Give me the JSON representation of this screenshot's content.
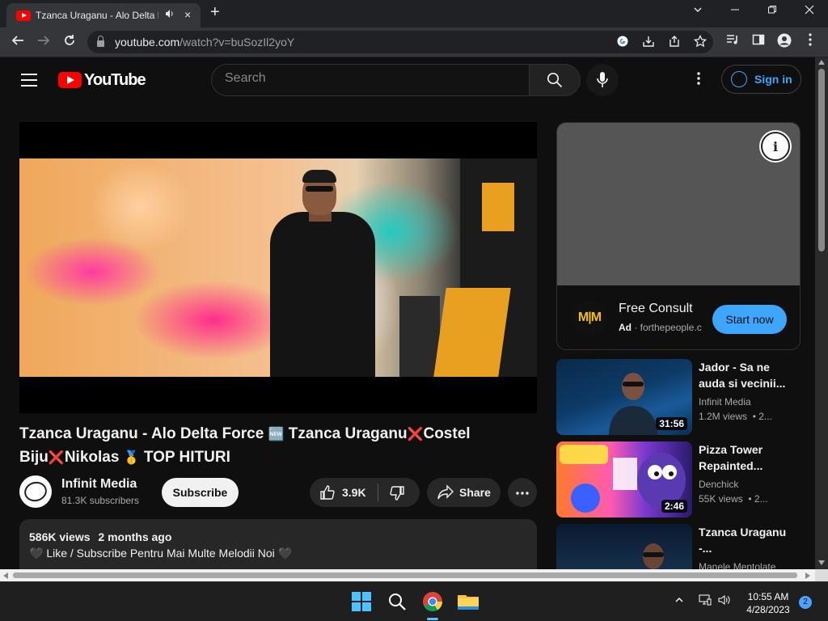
{
  "browser": {
    "tab_title": "Tzanca Uraganu - Alo Delta Force",
    "url_host": "youtube.com",
    "url_path": "/watch?v=buSozIl2yoY",
    "new_tab_symbol": "+",
    "close_symbol": "×"
  },
  "youtube": {
    "logo_text": "YouTube",
    "search_placeholder": "Search",
    "sign_in": "Sign in"
  },
  "video": {
    "title_part1": "Tzanca Uraganu - Alo Delta Force",
    "title_emoji1": "🆕",
    "title_part2": "Tzanca Uraganu",
    "title_emoji2": "❌",
    "title_part3": "Costel Biju",
    "title_emoji3": "❌",
    "title_part4": "Nikolas",
    "title_emoji4": "🥇",
    "title_part5": "TOP HITURI",
    "channel_name": "Infinit Media",
    "subscribers": "81.3K subscribers",
    "subscribe_label": "Subscribe",
    "likes": "3.9K",
    "share_label": "Share",
    "views": "586K views",
    "age": "2 months ago",
    "description_line": "🖤 Like / Subscribe Pentru Mai Multe Melodii Noi 🖤"
  },
  "ad": {
    "logo_text": "M|M",
    "title": "Free Consult",
    "ad_label": "Ad",
    "ad_domain": "forthepeople.c",
    "cta": "Start now"
  },
  "recommendations": [
    {
      "title": "Jador - Sa ne auda si vecinii...",
      "channel": "Infinit Media",
      "views": "1.2M views",
      "age": "• 2...",
      "duration": "31:56"
    },
    {
      "title": "Pizza Tower Repainted...",
      "channel": "Denchick",
      "views": "55K views",
      "age": "• 2...",
      "duration": "2:46"
    },
    {
      "title": "Tzanca Uraganu -...",
      "channel": "Manele Mentolate",
      "views": "",
      "age": "",
      "duration": ""
    }
  ],
  "taskbar": {
    "time": "10:55 AM",
    "date": "4/28/2023",
    "notifications": "2"
  },
  "colors": {
    "youtube_red": "#ff0000",
    "link_blue": "#3ea6ff",
    "background": "#0f0f0f"
  }
}
